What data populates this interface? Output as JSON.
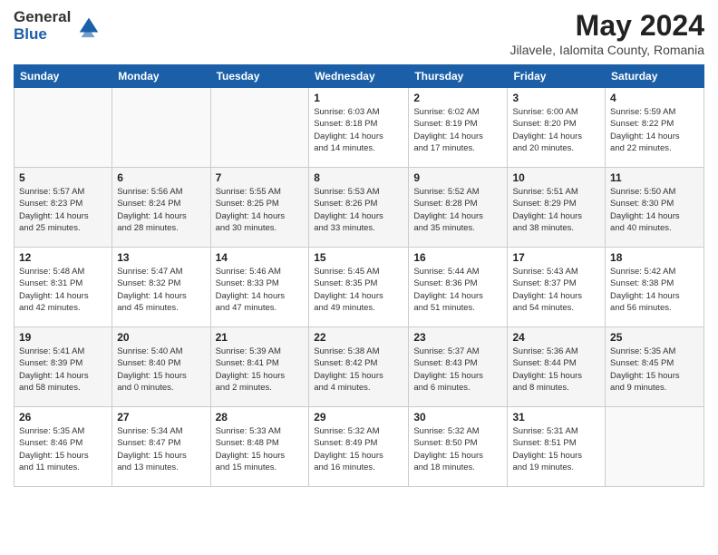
{
  "header": {
    "logo_line1": "General",
    "logo_line2": "Blue",
    "month_title": "May 2024",
    "location": "Jilavele, Ialomita County, Romania"
  },
  "weekdays": [
    "Sunday",
    "Monday",
    "Tuesday",
    "Wednesday",
    "Thursday",
    "Friday",
    "Saturday"
  ],
  "weeks": [
    [
      {
        "day": "",
        "detail": ""
      },
      {
        "day": "",
        "detail": ""
      },
      {
        "day": "",
        "detail": ""
      },
      {
        "day": "1",
        "detail": "Sunrise: 6:03 AM\nSunset: 8:18 PM\nDaylight: 14 hours\nand 14 minutes."
      },
      {
        "day": "2",
        "detail": "Sunrise: 6:02 AM\nSunset: 8:19 PM\nDaylight: 14 hours\nand 17 minutes."
      },
      {
        "day": "3",
        "detail": "Sunrise: 6:00 AM\nSunset: 8:20 PM\nDaylight: 14 hours\nand 20 minutes."
      },
      {
        "day": "4",
        "detail": "Sunrise: 5:59 AM\nSunset: 8:22 PM\nDaylight: 14 hours\nand 22 minutes."
      }
    ],
    [
      {
        "day": "5",
        "detail": "Sunrise: 5:57 AM\nSunset: 8:23 PM\nDaylight: 14 hours\nand 25 minutes."
      },
      {
        "day": "6",
        "detail": "Sunrise: 5:56 AM\nSunset: 8:24 PM\nDaylight: 14 hours\nand 28 minutes."
      },
      {
        "day": "7",
        "detail": "Sunrise: 5:55 AM\nSunset: 8:25 PM\nDaylight: 14 hours\nand 30 minutes."
      },
      {
        "day": "8",
        "detail": "Sunrise: 5:53 AM\nSunset: 8:26 PM\nDaylight: 14 hours\nand 33 minutes."
      },
      {
        "day": "9",
        "detail": "Sunrise: 5:52 AM\nSunset: 8:28 PM\nDaylight: 14 hours\nand 35 minutes."
      },
      {
        "day": "10",
        "detail": "Sunrise: 5:51 AM\nSunset: 8:29 PM\nDaylight: 14 hours\nand 38 minutes."
      },
      {
        "day": "11",
        "detail": "Sunrise: 5:50 AM\nSunset: 8:30 PM\nDaylight: 14 hours\nand 40 minutes."
      }
    ],
    [
      {
        "day": "12",
        "detail": "Sunrise: 5:48 AM\nSunset: 8:31 PM\nDaylight: 14 hours\nand 42 minutes."
      },
      {
        "day": "13",
        "detail": "Sunrise: 5:47 AM\nSunset: 8:32 PM\nDaylight: 14 hours\nand 45 minutes."
      },
      {
        "day": "14",
        "detail": "Sunrise: 5:46 AM\nSunset: 8:33 PM\nDaylight: 14 hours\nand 47 minutes."
      },
      {
        "day": "15",
        "detail": "Sunrise: 5:45 AM\nSunset: 8:35 PM\nDaylight: 14 hours\nand 49 minutes."
      },
      {
        "day": "16",
        "detail": "Sunrise: 5:44 AM\nSunset: 8:36 PM\nDaylight: 14 hours\nand 51 minutes."
      },
      {
        "day": "17",
        "detail": "Sunrise: 5:43 AM\nSunset: 8:37 PM\nDaylight: 14 hours\nand 54 minutes."
      },
      {
        "day": "18",
        "detail": "Sunrise: 5:42 AM\nSunset: 8:38 PM\nDaylight: 14 hours\nand 56 minutes."
      }
    ],
    [
      {
        "day": "19",
        "detail": "Sunrise: 5:41 AM\nSunset: 8:39 PM\nDaylight: 14 hours\nand 58 minutes."
      },
      {
        "day": "20",
        "detail": "Sunrise: 5:40 AM\nSunset: 8:40 PM\nDaylight: 15 hours\nand 0 minutes."
      },
      {
        "day": "21",
        "detail": "Sunrise: 5:39 AM\nSunset: 8:41 PM\nDaylight: 15 hours\nand 2 minutes."
      },
      {
        "day": "22",
        "detail": "Sunrise: 5:38 AM\nSunset: 8:42 PM\nDaylight: 15 hours\nand 4 minutes."
      },
      {
        "day": "23",
        "detail": "Sunrise: 5:37 AM\nSunset: 8:43 PM\nDaylight: 15 hours\nand 6 minutes."
      },
      {
        "day": "24",
        "detail": "Sunrise: 5:36 AM\nSunset: 8:44 PM\nDaylight: 15 hours\nand 8 minutes."
      },
      {
        "day": "25",
        "detail": "Sunrise: 5:35 AM\nSunset: 8:45 PM\nDaylight: 15 hours\nand 9 minutes."
      }
    ],
    [
      {
        "day": "26",
        "detail": "Sunrise: 5:35 AM\nSunset: 8:46 PM\nDaylight: 15 hours\nand 11 minutes."
      },
      {
        "day": "27",
        "detail": "Sunrise: 5:34 AM\nSunset: 8:47 PM\nDaylight: 15 hours\nand 13 minutes."
      },
      {
        "day": "28",
        "detail": "Sunrise: 5:33 AM\nSunset: 8:48 PM\nDaylight: 15 hours\nand 15 minutes."
      },
      {
        "day": "29",
        "detail": "Sunrise: 5:32 AM\nSunset: 8:49 PM\nDaylight: 15 hours\nand 16 minutes."
      },
      {
        "day": "30",
        "detail": "Sunrise: 5:32 AM\nSunset: 8:50 PM\nDaylight: 15 hours\nand 18 minutes."
      },
      {
        "day": "31",
        "detail": "Sunrise: 5:31 AM\nSunset: 8:51 PM\nDaylight: 15 hours\nand 19 minutes."
      },
      {
        "day": "",
        "detail": ""
      }
    ]
  ]
}
